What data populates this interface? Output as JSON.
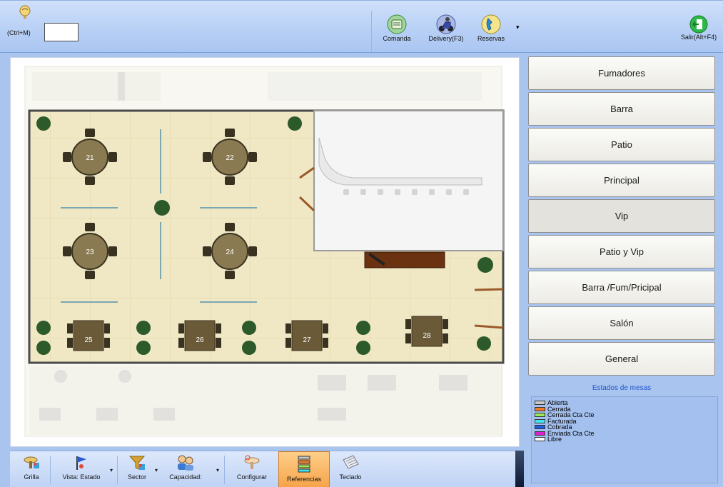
{
  "top_toolbar": {
    "shortcut_label": "(Ctrl+M)",
    "command_value": "",
    "buttons": [
      {
        "label": "Comanda",
        "icon": "comanda-icon"
      },
      {
        "label": "Delivery(F3)",
        "icon": "delivery-scooter-icon"
      },
      {
        "label": "Reservas",
        "icon": "phone-icon"
      }
    ],
    "exit_label": "Salir(Alt+F4)"
  },
  "floor_plan": {
    "round_tables": [
      {
        "number": "21"
      },
      {
        "number": "22"
      },
      {
        "number": "23"
      },
      {
        "number": "24"
      }
    ],
    "square_tables": [
      {
        "number": "25"
      },
      {
        "number": "26"
      },
      {
        "number": "27"
      },
      {
        "number": "28"
      }
    ]
  },
  "sectors": [
    {
      "label": "Fumadores",
      "active": false
    },
    {
      "label": "Barra",
      "active": false
    },
    {
      "label": "Patio",
      "active": false
    },
    {
      "label": "Principal",
      "active": false
    },
    {
      "label": "Vip",
      "active": true
    },
    {
      "label": "Patio y Vip",
      "active": false
    },
    {
      "label": "Barra /Fum/Pricipal",
      "active": false
    },
    {
      "label": "Salón",
      "active": false
    },
    {
      "label": "General",
      "active": false
    }
  ],
  "estados": {
    "title": "Estados de mesas",
    "items": [
      {
        "label": "Abierta",
        "color": "#c8c8c8"
      },
      {
        "label": "Cerrada",
        "color": "#f07a28"
      },
      {
        "label": "Cerrada Cta Cte",
        "color": "#9be65a"
      },
      {
        "label": "Facturada",
        "color": "#3fe6f0"
      },
      {
        "label": "Cobrada",
        "color": "#1f5fe0"
      },
      {
        "label": "Enviada Cta Cte",
        "color": "#e020d0"
      },
      {
        "label": "Libre",
        "color": "#ffffff"
      }
    ]
  },
  "bottom_toolbar": {
    "grilla": "Grilla",
    "vista": "Vista: Estado",
    "sector": "Sector",
    "capacidad": "Capacidad:",
    "configurar": "Configurar",
    "referencias": "Referencias",
    "teclado": "Teclado"
  }
}
